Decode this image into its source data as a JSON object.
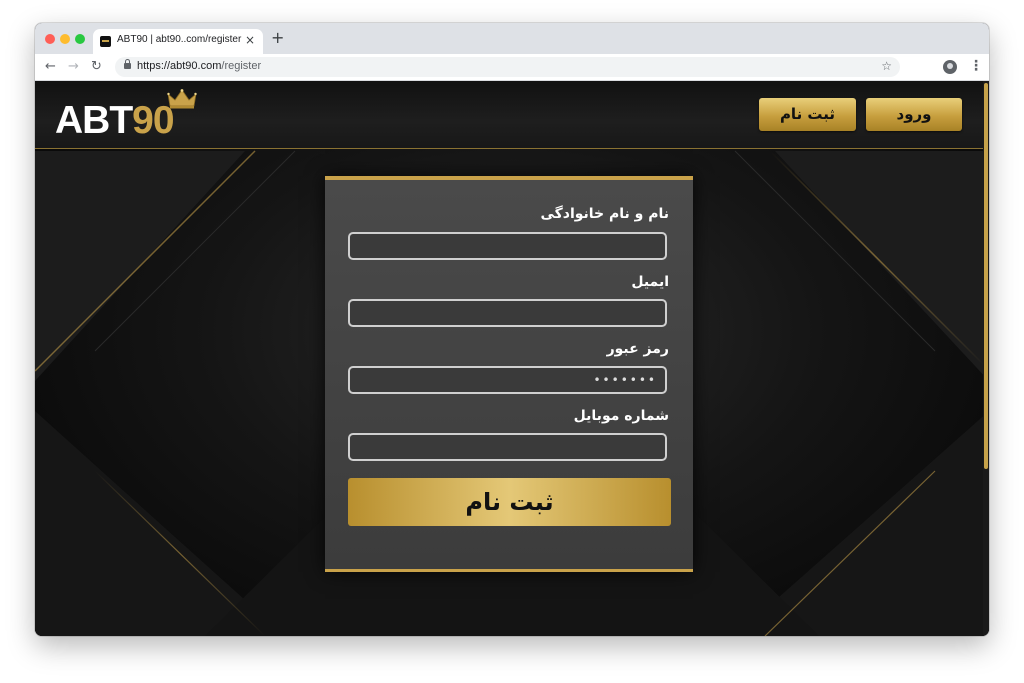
{
  "browser": {
    "tab_title": "ABT90 | abt90..com/register",
    "tab_close": "×",
    "new_tab": "+",
    "url_host": "https://abt90.com",
    "url_path": "/register",
    "nav_back": "←",
    "nav_forward": "→",
    "nav_reload": "↻",
    "bookmark": "☆",
    "menu": "⋮"
  },
  "site": {
    "logo_text": "ABT",
    "logo_number": "90",
    "header_buttons": {
      "register": "ثبت نام",
      "login": "ورود"
    }
  },
  "form": {
    "fields": [
      {
        "label": "نام و نام خانوادگی",
        "value": ""
      },
      {
        "label": "ایمیل",
        "value": ""
      },
      {
        "label": "رمز عبور",
        "value": "•••••••"
      },
      {
        "label": "شماره موبایل",
        "value": ""
      }
    ],
    "submit_label": "ثبت نام"
  },
  "colors": {
    "gold": "#c9a24a",
    "background": "#111111",
    "card": "#444444"
  }
}
